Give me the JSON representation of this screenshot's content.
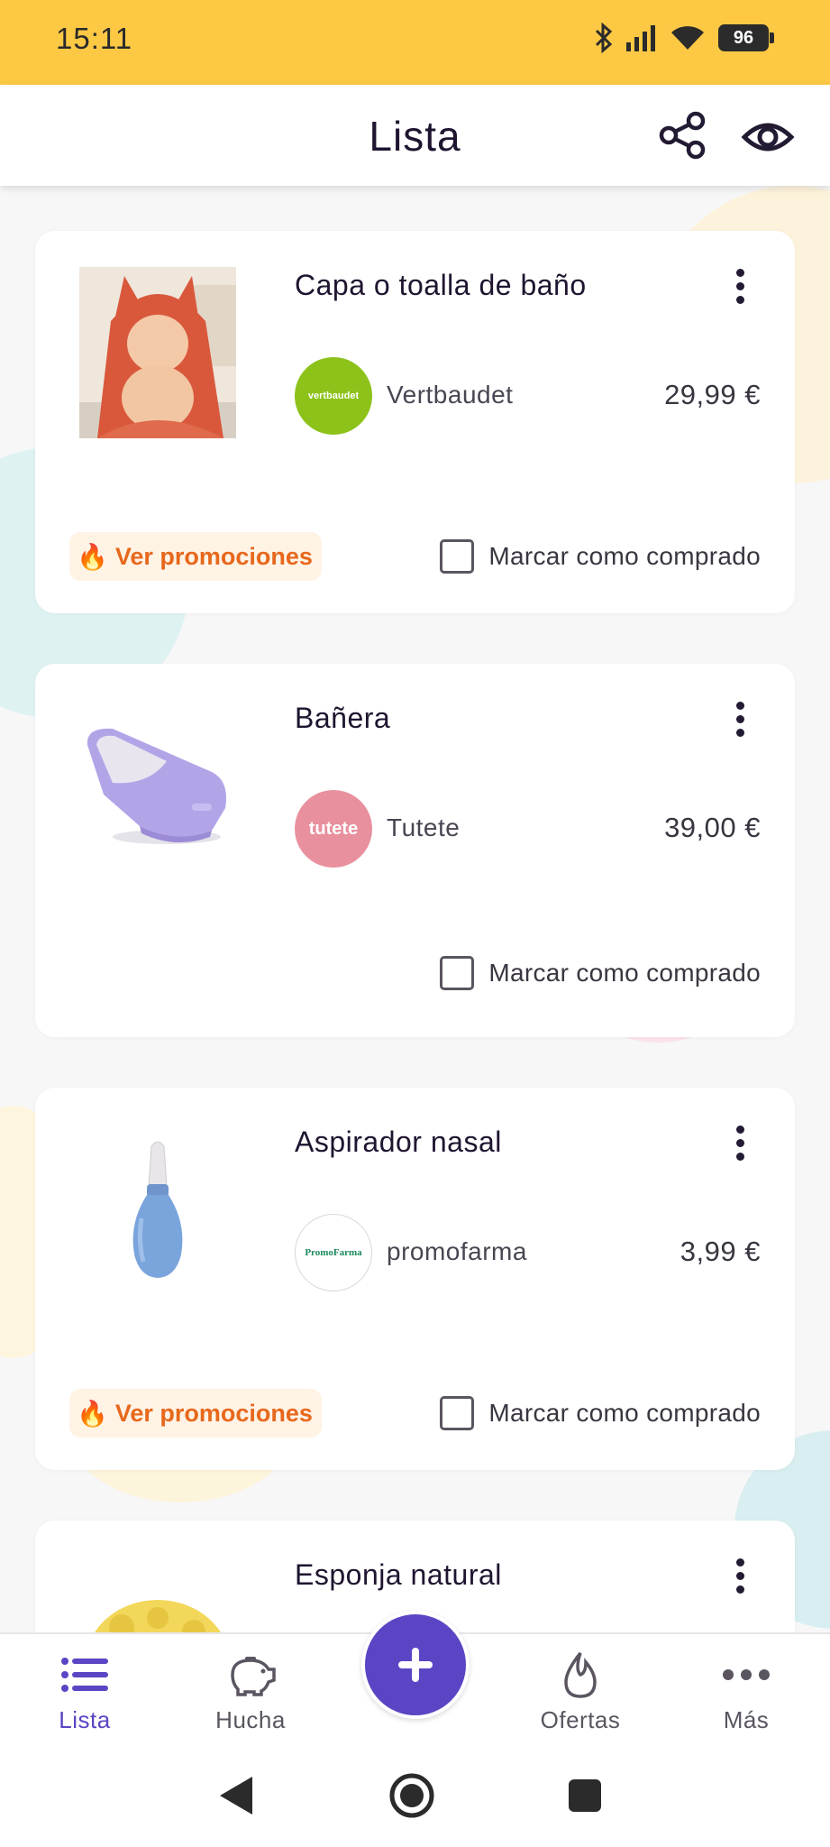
{
  "status_bar": {
    "time": "15:11",
    "battery": "96",
    "icons": [
      "bluetooth-icon",
      "signal-icon",
      "wifi-icon",
      "battery-icon"
    ]
  },
  "app_bar": {
    "title": "Lista",
    "actions": [
      "share-icon",
      "eye-icon"
    ]
  },
  "items": [
    {
      "name": "Capa o toalla de baño",
      "store": "Vertbaudet",
      "store_logo_text": "vertbaudet",
      "store_color": "#8cc21a",
      "price": "29,99 €",
      "promo": "Ver promociones",
      "mark_label": "Marcar como comprado"
    },
    {
      "name": "Bañera",
      "store": "Tutete",
      "store_logo_text": "tutete",
      "store_color": "#e9909e",
      "price": "39,00 €",
      "mark_label": "Marcar como comprado"
    },
    {
      "name": "Aspirador nasal",
      "store": "promofarma",
      "store_logo_text": "PromoFarma",
      "store_color": "#ffffff",
      "price": "3,99 €",
      "promo": "Ver promociones",
      "mark_label": "Marcar como comprado"
    },
    {
      "name": "Esponja natural"
    }
  ],
  "bottom_nav": {
    "items": [
      {
        "label": "Lista",
        "icon": "list-icon",
        "active": true
      },
      {
        "label": "Hucha",
        "icon": "piggy-bank-icon",
        "active": false
      },
      {
        "label": "Ofertas",
        "icon": "flame-icon",
        "active": false
      },
      {
        "label": "Más",
        "icon": "more-icon",
        "active": false
      }
    ],
    "fab_icon": "plus-icon"
  },
  "colors": {
    "status_bar": "#fdc944",
    "accent": "#5b45c4",
    "promo": "#e7681c"
  }
}
